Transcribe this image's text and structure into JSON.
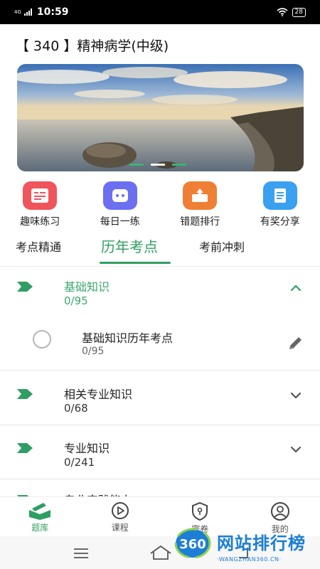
{
  "status_bar": {
    "network": "4G",
    "time": "10:59",
    "battery": "28"
  },
  "title": "【 340 】精神病学(中级)",
  "quick_actions": [
    {
      "label": "趣味练习",
      "icon": "practice-icon",
      "color": "#f0555c"
    },
    {
      "label": "每日一练",
      "icon": "daily-icon",
      "color": "#6b6ff0"
    },
    {
      "label": "错题排行",
      "icon": "ranking-icon",
      "color": "#f07f36"
    },
    {
      "label": "有奖分享",
      "icon": "share-icon",
      "color": "#3aa0f0"
    }
  ],
  "tabs": [
    {
      "label": "考点精通",
      "active": false
    },
    {
      "label": "历年考点",
      "active": true
    },
    {
      "label": "考前冲刺",
      "active": false
    }
  ],
  "chapters": [
    {
      "name": "基础知识",
      "progress": "0/95",
      "expanded": true,
      "items": [
        {
          "name": "基础知识历年考点",
          "progress": "0/95"
        }
      ]
    },
    {
      "name": "相关专业知识",
      "progress": "0/68",
      "expanded": false
    },
    {
      "name": "专业知识",
      "progress": "0/241",
      "expanded": false
    },
    {
      "name": "专业实践能力",
      "progress": "",
      "expanded": false
    }
  ],
  "bottom_nav": [
    {
      "label": "题库",
      "icon": "question-bank-icon",
      "active": true
    },
    {
      "label": "课程",
      "icon": "course-play-icon",
      "active": false
    },
    {
      "label": "密卷",
      "icon": "secret-paper-icon",
      "active": false
    },
    {
      "label": "我的",
      "icon": "profile-icon",
      "active": false
    }
  ],
  "watermark": {
    "badge": "360",
    "title": "网站排行榜",
    "subtitle": "·WANGZHAN360.CN·"
  },
  "colors": {
    "accent": "#2f9e62",
    "accent_light": "#3aa86b"
  }
}
